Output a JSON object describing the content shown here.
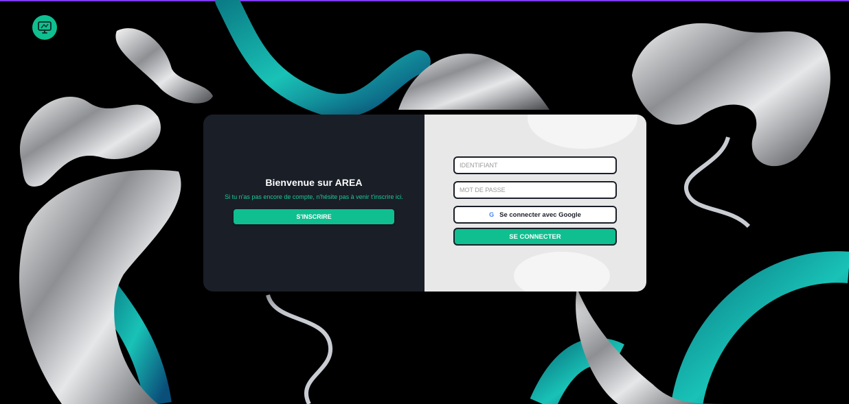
{
  "colors": {
    "accent": "#0fbf90",
    "top_bar": "#7c3aed",
    "panel_dark": "#1a1e27",
    "panel_light": "#e8e8e9",
    "link_text": "#19c99a"
  },
  "logo": {
    "icon": "monitor-icon"
  },
  "welcome": {
    "title": "Bienvenue sur AREA",
    "subtitle": "Si tu n'as pas encore de compte, n'hésite pas à venir t'inscrire ici.",
    "signup_label": "S'INSCRIRE"
  },
  "login": {
    "identifier_placeholder": "IDENTIFIANT",
    "password_placeholder": "MOT DE PASSE",
    "google_icon": "google-icon",
    "google_label": "Se connecter avec Google",
    "submit_label": "SE CONNECTER"
  }
}
